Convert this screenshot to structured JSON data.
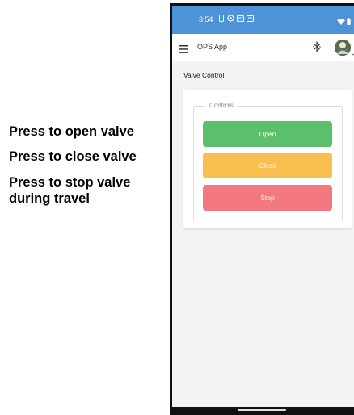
{
  "annotations": {
    "open": "Press to open valve",
    "close": "Press to close valve",
    "stop_line1": "Press to stop valve",
    "stop_line2": "during travel"
  },
  "status_bar": {
    "time": "3:54",
    "color": "#4e92d7",
    "left_icons": [
      "sim-icon",
      "target-icon",
      "cast-icon",
      "cast-icon"
    ],
    "right_icons": [
      "wifi-icon",
      "battery-icon"
    ]
  },
  "app_bar": {
    "title": "OPS App",
    "icons": [
      "menu-icon",
      "bluetooth-icon",
      "avatar",
      "chevron-down-icon"
    ]
  },
  "page": {
    "section_title": "Valve Control",
    "controls": {
      "legend": "Controls",
      "buttons": [
        {
          "label": "Open",
          "color": "#5cbf6e"
        },
        {
          "label": "Close",
          "color": "#f8bf4e"
        },
        {
          "label": "Stop",
          "color": "#f4787f"
        }
      ]
    }
  }
}
